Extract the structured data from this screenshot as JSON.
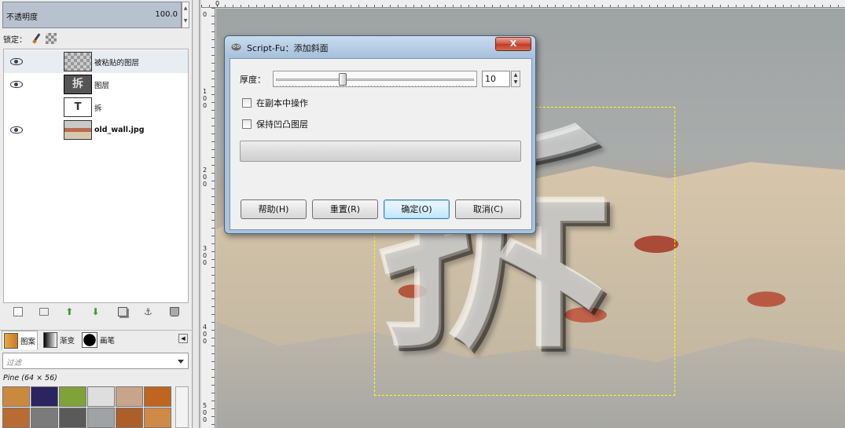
{
  "layers_panel": {
    "opacity_label": "不透明度",
    "opacity_value": "100.0",
    "lock_label": "锁定：",
    "layers": [
      {
        "name": "被粘贴的图层",
        "visible": true,
        "thumb_type": "checker-text",
        "bold": false
      },
      {
        "name": "图层",
        "visible": true,
        "thumb_type": "text-bevel",
        "bold": false
      },
      {
        "name": "拆",
        "visible": false,
        "thumb_type": "text-layer",
        "bold": false
      },
      {
        "name": "old_wall.jpg",
        "visible": true,
        "thumb_type": "wall-image",
        "bold": true
      }
    ],
    "toolbar_icons": [
      "new-layer-icon",
      "folder-icon",
      "raise-layer-icon",
      "lower-layer-icon",
      "duplicate-layer-icon",
      "anchor-icon",
      "trash-icon"
    ]
  },
  "brushes_panel": {
    "tabs": [
      {
        "label": "图案",
        "icon": "pattern-tab-icon",
        "active": true
      },
      {
        "label": "渐变",
        "icon": "gradient-tab-icon",
        "active": false
      },
      {
        "label": "画笔",
        "icon": "brush-tab-icon",
        "active": false
      }
    ],
    "filter_placeholder": "过滤",
    "pattern_name": "Pine (64 × 56)",
    "patterns": [
      "#c98a3e",
      "#2a2560",
      "#7fa23a",
      "#dedede",
      "#c7a58a",
      "#c0651f",
      "#b86b32",
      "#7b7b7b",
      "#5a5a5a",
      "#9fa3a5",
      "#ad5f2a",
      "#d08a48"
    ]
  },
  "canvas": {
    "ruler_left_labels": [
      "0",
      "1\n0\n0",
      "2\n0\n0",
      "3\n0\n0",
      "4\n0\n0",
      "5\n0\n0"
    ],
    "ruler_top_label": "0",
    "bevel_text": "拆"
  },
  "dialog": {
    "title": "Script-Fu：添加斜面",
    "close_label": "X",
    "thickness_label": "厚度：",
    "thickness_value": "10",
    "thickness_min": 0,
    "thickness_max": 30,
    "work_on_copy_label": "在副本中操作",
    "work_on_copy_checked": false,
    "keep_bump_label": "保持凹凸图层",
    "keep_bump_checked": false,
    "buttons": {
      "help": "帮助(H)",
      "reset": "重置(R)",
      "ok": "确定(O)",
      "cancel": "取消(C)"
    }
  }
}
